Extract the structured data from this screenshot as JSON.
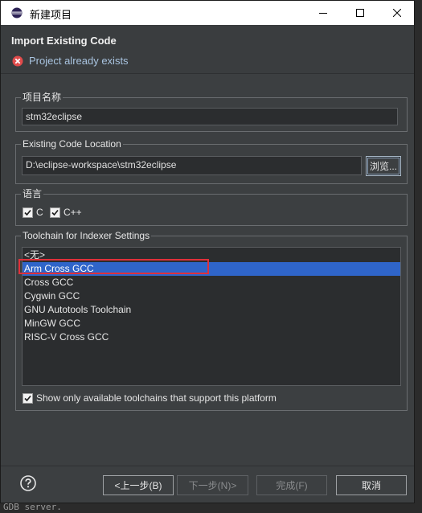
{
  "window": {
    "title": "新建项目"
  },
  "header": {
    "title": "Import Existing Code",
    "message": "Project already exists"
  },
  "project_name": {
    "label": "项目名称",
    "value": "stm32eclipse"
  },
  "location": {
    "label": "Existing Code Location",
    "value": "D:\\eclipse-workspace\\stm32eclipse",
    "browse_label": "浏览..."
  },
  "language": {
    "label": "语言",
    "options": [
      {
        "label": "C",
        "checked": true
      },
      {
        "label": "C++",
        "checked": true
      }
    ]
  },
  "toolchain": {
    "label": "Toolchain for Indexer Settings",
    "items": [
      "<无>",
      "Arm Cross GCC",
      "Cross GCC",
      "Cygwin GCC",
      "GNU Autotools Toolchain",
      "MinGW GCC",
      "RISC-V Cross GCC"
    ],
    "selected_index": 1,
    "show_available_label": "Show only available toolchains that support this platform",
    "show_available_checked": true
  },
  "buttons": {
    "back": "<上一步(B)",
    "next": "下一步(N)>",
    "finish": "完成(F)",
    "cancel": "取消"
  },
  "background": {
    "status_text": "GDB server."
  },
  "colors": {
    "selection": "#2f65ca",
    "highlight_box": "#e0303a",
    "error": "#e04b4b",
    "accent_text": "#a9c4e0"
  },
  "icons": {
    "app": "eclipse-icon",
    "error": "error-icon",
    "help": "help-icon"
  }
}
